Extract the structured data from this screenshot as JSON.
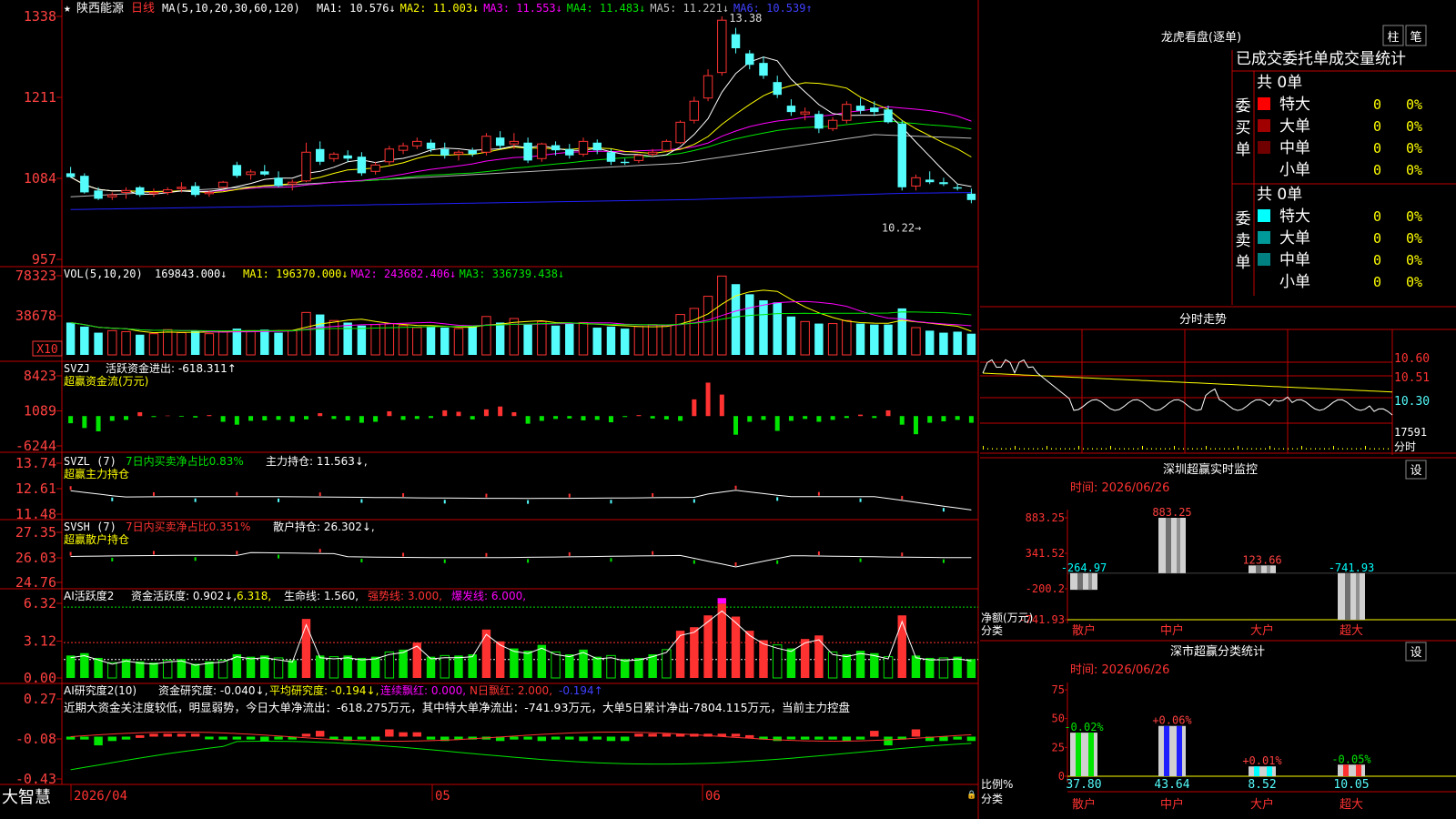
{
  "colors": {
    "up": "#ff3232",
    "down": "#54fcfc",
    "axis": "#c00000",
    "white": "#ffffff",
    "yellow": "#ffff00",
    "magenta": "#ff00ff",
    "green": "#00e600",
    "gray": "#c0c0c0",
    "blue": "#2020ff",
    "label": "#ff4040",
    "bg": "#000000"
  },
  "header": {
    "star": "★",
    "stock": "陕西能源",
    "period": "日线",
    "ma_label": "MA(5,10,20,30,60,120)",
    "ma": [
      {
        "t": "MA1: 10.576↓",
        "c": "#ffffff"
      },
      {
        "t": "MA2: 11.003↓",
        "c": "#ffff00"
      },
      {
        "t": "MA3: 11.553↓",
        "c": "#ff00ff"
      },
      {
        "t": "MA4: 11.483↓",
        "c": "#00e600"
      },
      {
        "t": "MA5: 11.221↓",
        "c": "#c0c0c0"
      },
      {
        "t": "MA6: 10.539↑",
        "c": "#4040ff"
      }
    ]
  },
  "price_panel": {
    "ticks": [
      "13.38",
      "12.11",
      "10.84",
      "9.57"
    ],
    "high_label": "13.38",
    "low_label": "10.22"
  },
  "vol_panel": {
    "label": "VOL(5,10,20)",
    "value": "169843.000↓",
    "ma": [
      {
        "t": "MA1: 196370.000↓",
        "c": "#ffff00"
      },
      {
        "t": "MA2: 243682.406↓",
        "c": "#ff00ff"
      },
      {
        "t": "MA3: 336739.438↓",
        "c": "#00e600"
      }
    ],
    "ticks": [
      "78323",
      "38678"
    ],
    "unit": "X10"
  },
  "svzj_panel": {
    "name": "SVZJ",
    "desc": "活跃资金进出: -618.311↑",
    "sub": "超赢资金流(万元)",
    "ticks": [
      "8423",
      "1089",
      "-6244"
    ]
  },
  "svzl_panel": {
    "name": "SVZL (7)",
    "desc": "7日内买卖净占比0.83%",
    "extra": "主力持仓: 11.563↓,",
    "sub": "超赢主力持仓",
    "ticks": [
      "13.74",
      "12.61",
      "11.48"
    ]
  },
  "svsh_panel": {
    "name": "SVSH (7)",
    "desc": "7日内买卖净占比0.351%",
    "extra": "散户持仓: 26.302↓,",
    "sub": "超赢散户持仓",
    "ticks": [
      "27.35",
      "26.03",
      "24.76"
    ]
  },
  "ai1_panel": {
    "name": "AI活跃度2",
    "items": [
      {
        "t": "资金活跃度: 0.902↓,",
        "c": "#ffffff"
      },
      {
        "t": "6.318,",
        "c": "#ffff00"
      },
      {
        "t": "生命线: 1.560,",
        "c": "#ffffff"
      },
      {
        "t": "强势线: 3.000,",
        "c": "#ff3232"
      },
      {
        "t": "爆发线: 6.000,",
        "c": "#ff00ff"
      }
    ],
    "ticks": [
      "6.32",
      "3.12",
      "0.00"
    ]
  },
  "ai2_panel": {
    "name": "AI研究度2(10)",
    "items": [
      {
        "t": "资金研究度: -0.040↓,",
        "c": "#ffffff"
      },
      {
        "t": "平均研究度: -0.194↓,",
        "c": "#ffff00"
      },
      {
        "t": "连续飘红: 0.000,",
        "c": "#ff00ff"
      },
      {
        "t": "N日飘红: 2.000,",
        "c": "#ff3232"
      },
      {
        "t": "-0.194↑",
        "c": "#4040ff"
      }
    ],
    "text": "近期大资金关注度较低，明显弱势，今日大单净流出：-618.275万元，其中特大单净流出：-741.93万元，大单5日累计净出-7804.115万元，当前主力控盘",
    "ticks": [
      "0.27",
      "-0.08",
      "-0.43"
    ]
  },
  "footer": {
    "brand": "大智慧",
    "dates": [
      "2026/04",
      "05",
      "06"
    ]
  },
  "chart_data": {
    "type": "candlestick",
    "price_range": [
      9.57,
      13.38
    ],
    "candles": [
      [
        10.92,
        11.02,
        10.85,
        10.86
      ],
      [
        10.88,
        10.92,
        10.6,
        10.62
      ],
      [
        10.65,
        10.7,
        10.5,
        10.52
      ],
      [
        10.55,
        10.62,
        10.5,
        10.58
      ],
      [
        10.62,
        10.7,
        10.52,
        10.65
      ],
      [
        10.7,
        10.72,
        10.55,
        10.58
      ],
      [
        10.6,
        10.68,
        10.55,
        10.62
      ],
      [
        10.62,
        10.7,
        10.58,
        10.66
      ],
      [
        10.68,
        10.78,
        10.62,
        10.7
      ],
      [
        10.72,
        10.78,
        10.55,
        10.58
      ],
      [
        10.6,
        10.65,
        10.55,
        10.62
      ],
      [
        10.7,
        10.8,
        10.68,
        10.78
      ],
      [
        11.05,
        11.1,
        10.85,
        10.88
      ],
      [
        10.9,
        10.98,
        10.82,
        10.94
      ],
      [
        10.95,
        11.05,
        10.88,
        10.9
      ],
      [
        10.85,
        10.95,
        10.7,
        10.72
      ],
      [
        10.75,
        10.82,
        10.65,
        10.78
      ],
      [
        10.8,
        11.4,
        10.78,
        11.25
      ],
      [
        11.3,
        11.42,
        11.05,
        11.1
      ],
      [
        11.15,
        11.25,
        11.1,
        11.22
      ],
      [
        11.2,
        11.28,
        11.1,
        11.15
      ],
      [
        11.18,
        11.25,
        10.88,
        10.92
      ],
      [
        10.95,
        11.1,
        10.9,
        11.05
      ],
      [
        11.1,
        11.35,
        11.05,
        11.3
      ],
      [
        11.28,
        11.4,
        11.22,
        11.35
      ],
      [
        11.35,
        11.48,
        11.3,
        11.42
      ],
      [
        11.4,
        11.45,
        11.25,
        11.3
      ],
      [
        11.3,
        11.4,
        11.15,
        11.2
      ],
      [
        11.22,
        11.28,
        11.12,
        11.25
      ],
      [
        11.28,
        11.32,
        11.18,
        11.22
      ],
      [
        11.25,
        11.55,
        11.2,
        11.5
      ],
      [
        11.48,
        11.58,
        11.3,
        11.35
      ],
      [
        11.38,
        11.55,
        11.3,
        11.42
      ],
      [
        11.4,
        11.48,
        11.08,
        11.12
      ],
      [
        11.15,
        11.4,
        11.1,
        11.38
      ],
      [
        11.36,
        11.42,
        11.2,
        11.28
      ],
      [
        11.3,
        11.38,
        11.15,
        11.2
      ],
      [
        11.22,
        11.48,
        11.18,
        11.42
      ],
      [
        11.4,
        11.45,
        11.22,
        11.28
      ],
      [
        11.25,
        11.3,
        11.05,
        11.1
      ],
      [
        11.1,
        11.15,
        11.05,
        11.08
      ],
      [
        11.12,
        11.22,
        11.08,
        11.2
      ],
      [
        11.22,
        11.3,
        11.18,
        11.25
      ],
      [
        11.28,
        11.45,
        11.25,
        11.42
      ],
      [
        11.4,
        11.75,
        11.38,
        11.72
      ],
      [
        11.75,
        12.12,
        11.7,
        12.05
      ],
      [
        12.1,
        12.55,
        12.05,
        12.45
      ],
      [
        12.5,
        13.38,
        12.45,
        13.32
      ],
      [
        13.1,
        13.2,
        12.8,
        12.88
      ],
      [
        12.8,
        12.85,
        12.55,
        12.62
      ],
      [
        12.65,
        12.75,
        12.4,
        12.45
      ],
      [
        12.35,
        12.45,
        12.1,
        12.15
      ],
      [
        11.98,
        12.08,
        11.82,
        11.88
      ],
      [
        11.85,
        11.95,
        11.75,
        11.88
      ],
      [
        11.85,
        11.9,
        11.55,
        11.62
      ],
      [
        11.62,
        11.8,
        11.58,
        11.75
      ],
      [
        11.75,
        12.05,
        11.7,
        12.0
      ],
      [
        11.98,
        12.1,
        11.85,
        11.9
      ],
      [
        11.95,
        12.05,
        11.82,
        11.88
      ],
      [
        11.92,
        11.98,
        11.7,
        11.72
      ],
      [
        11.7,
        11.75,
        10.65,
        10.7
      ],
      [
        10.72,
        10.9,
        10.65,
        10.85
      ],
      [
        10.82,
        10.95,
        10.75,
        10.78
      ],
      [
        10.78,
        10.85,
        10.72,
        10.75
      ],
      [
        10.7,
        10.75,
        10.65,
        10.68
      ],
      [
        10.6,
        10.68,
        10.45,
        10.5
      ]
    ],
    "vol_range": [
      0,
      78323
    ],
    "volumes": [
      32000,
      28000,
      22000,
      24000,
      23000,
      20000,
      21000,
      25000,
      22000,
      24000,
      21000,
      23000,
      26000,
      24000,
      25000,
      22000,
      24000,
      42000,
      40000,
      34000,
      32000,
      29000,
      30000,
      31000,
      29000,
      27000,
      28000,
      27000,
      26000,
      29000,
      38000,
      32000,
      36000,
      30000,
      33000,
      29000,
      31000,
      32000,
      27000,
      28000,
      26000,
      28000,
      30000,
      29000,
      40000,
      46000,
      58000,
      78000,
      70000,
      60000,
      54000,
      52000,
      38000,
      33000,
      31000,
      31000,
      34000,
      31000,
      30000,
      30000,
      46000,
      27000,
      24000,
      22000,
      23000,
      21000
    ],
    "svzj_range": [
      -6244,
      8423
    ],
    "svzj": [
      -1500,
      -2500,
      -3200,
      -1000,
      -800,
      800,
      -200,
      100,
      -150,
      -300,
      200,
      -1200,
      -1800,
      -1000,
      -900,
      -800,
      -1200,
      -700,
      600,
      -600,
      -900,
      -1400,
      -1200,
      1000,
      -800,
      -600,
      -400,
      1200,
      900,
      -700,
      1400,
      2000,
      800,
      -1600,
      -1000,
      -600,
      -500,
      -900,
      -800,
      -1300,
      -200,
      200,
      -500,
      -700,
      -1000,
      3500,
      7000,
      4500,
      -3900,
      -1200,
      -800,
      -3100,
      -1000,
      -600,
      -1200,
      -800,
      -400,
      300,
      -400,
      1200,
      -1800,
      -3800,
      -1400,
      -1100,
      -800,
      -1400
    ],
    "svzl_range": [
      11.48,
      13.74
    ],
    "svsh_range": [
      24.76,
      27.35
    ],
    "ai1_range": [
      0,
      6.32
    ],
    "ai1": [
      1.9,
      2.1,
      1.7,
      1.3,
      1.6,
      1.4,
      1.3,
      1.5,
      1.6,
      1.2,
      1.4,
      1.5,
      2.0,
      1.8,
      1.9,
      1.7,
      1.5,
      5.0,
      1.9,
      1.8,
      1.9,
      1.7,
      1.8,
      2.2,
      2.4,
      3.0,
      1.8,
      1.9,
      1.9,
      2.0,
      4.1,
      3.1,
      2.5,
      2.3,
      2.8,
      2.2,
      2.0,
      2.4,
      1.8,
      1.9,
      1.6,
      1.7,
      2.0,
      2.4,
      4.0,
      4.3,
      5.3,
      6.3,
      5.2,
      4.0,
      3.2,
      2.8,
      2.5,
      3.3,
      3.6,
      2.2,
      2.0,
      2.3,
      2.1,
      1.8,
      5.3,
      1.9,
      1.7,
      1.7,
      1.8,
      1.6
    ],
    "ai2_range": [
      -0.43,
      0.27
    ],
    "ai2": [
      -0.02,
      -0.02,
      -0.06,
      -0.03,
      -0.02,
      0.01,
      0.02,
      0.02,
      0.02,
      0.02,
      -0.01,
      -0.02,
      -0.02,
      -0.02,
      -0.03,
      -0.02,
      -0.02,
      0.02,
      0.04,
      -0.02,
      -0.03,
      -0.02,
      -0.03,
      0.05,
      0.03,
      0.03,
      -0.02,
      -0.03,
      -0.02,
      -0.02,
      -0.02,
      -0.03,
      -0.02,
      -0.02,
      -0.03,
      -0.02,
      -0.02,
      -0.03,
      -0.02,
      -0.03,
      -0.03,
      0.02,
      0.02,
      0.02,
      0.02,
      0.02,
      0.02,
      0.02,
      0.02,
      0.01,
      -0.02,
      -0.03,
      -0.01,
      -0.02,
      -0.02,
      -0.02,
      -0.03,
      -0.02,
      0.04,
      -0.06,
      -0.02,
      0.05,
      -0.03,
      -0.03,
      -0.02,
      -0.03
    ]
  },
  "right": {
    "lhb_title": "龙虎看盘(逐单)",
    "btn_zhu": "柱",
    "btn_bi": "笔",
    "trade_title": "已成交委托单成交量统计",
    "buy_label": "委买单",
    "sell_label": "委卖单",
    "buy_total": "共 0单",
    "sell_total": "共 0单",
    "buy_rows": [
      {
        "name": "特大",
        "v": "0",
        "p": "0%",
        "c": "#ff0000"
      },
      {
        "name": "大单",
        "v": "0",
        "p": "0%",
        "c": "#a00000"
      },
      {
        "name": "中单",
        "v": "0",
        "p": "0%",
        "c": "#700000"
      },
      {
        "name": "小单",
        "v": "0",
        "p": "0%",
        "c": "#000000"
      }
    ],
    "sell_rows": [
      {
        "name": "特大",
        "v": "0",
        "p": "0%",
        "c": "#00ffff"
      },
      {
        "name": "大单",
        "v": "0",
        "p": "0%",
        "c": "#009999"
      },
      {
        "name": "中单",
        "v": "0",
        "p": "0%",
        "c": "#008080"
      },
      {
        "name": "小单",
        "v": "0",
        "p": "0%",
        "c": "#000000"
      }
    ],
    "ts_title": "分时走势",
    "ts_ticks": [
      "10.60",
      "10.51",
      "10.30"
    ],
    "ts_vol": "17591",
    "ts_unit": "分时",
    "mon_title": "深圳超赢实时监控",
    "mon_set": "设",
    "mon_time": "时间: 2026/06/26",
    "mon_ticks": [
      "883.25",
      "341.52",
      "-200.2",
      "-741.93"
    ],
    "mon_ylabel": "净额(万元)",
    "mon_xlabel": "分类",
    "mon_bars": [
      {
        "cat": "散户",
        "v": -264.97,
        "label": "-264.97",
        "lc": "#00ffff"
      },
      {
        "cat": "中户",
        "v": 883.25,
        "label": "883.25",
        "lc": "#ff4040"
      },
      {
        "cat": "大户",
        "v": 123.66,
        "label": "123.66",
        "lc": "#ff4040"
      },
      {
        "cat": "超大",
        "v": -741.93,
        "label": "-741.93",
        "lc": "#00ffff"
      }
    ],
    "mon_range": [
      -741.93,
      883.25
    ],
    "cls_title": "深市超赢分类统计",
    "cls_set": "设",
    "cls_time": "时间: 2026/06/26",
    "cls_ticks": [
      "75",
      "50",
      "25",
      "0"
    ],
    "cls_ylabel": "比例%",
    "cls_xlabel": "分类",
    "cls_bars": [
      {
        "cat": "散户",
        "v": 37.8,
        "val": "37.80",
        "chg": "-0.02%",
        "cc": "#00e600",
        "fill": "#00e600"
      },
      {
        "cat": "中户",
        "v": 43.64,
        "val": "43.64",
        "chg": "+0.06%",
        "cc": "#ff4040",
        "fill": "#2020ff"
      },
      {
        "cat": "大户",
        "v": 8.52,
        "val": "8.52",
        "chg": "+0.01%",
        "cc": "#ff4040",
        "fill": "#00ffff"
      },
      {
        "cat": "超大",
        "v": 10.05,
        "val": "10.05",
        "chg": "-0.05%",
        "cc": "#00e600",
        "fill": "#ff3030"
      }
    ],
    "cls_range": [
      0,
      75
    ]
  }
}
